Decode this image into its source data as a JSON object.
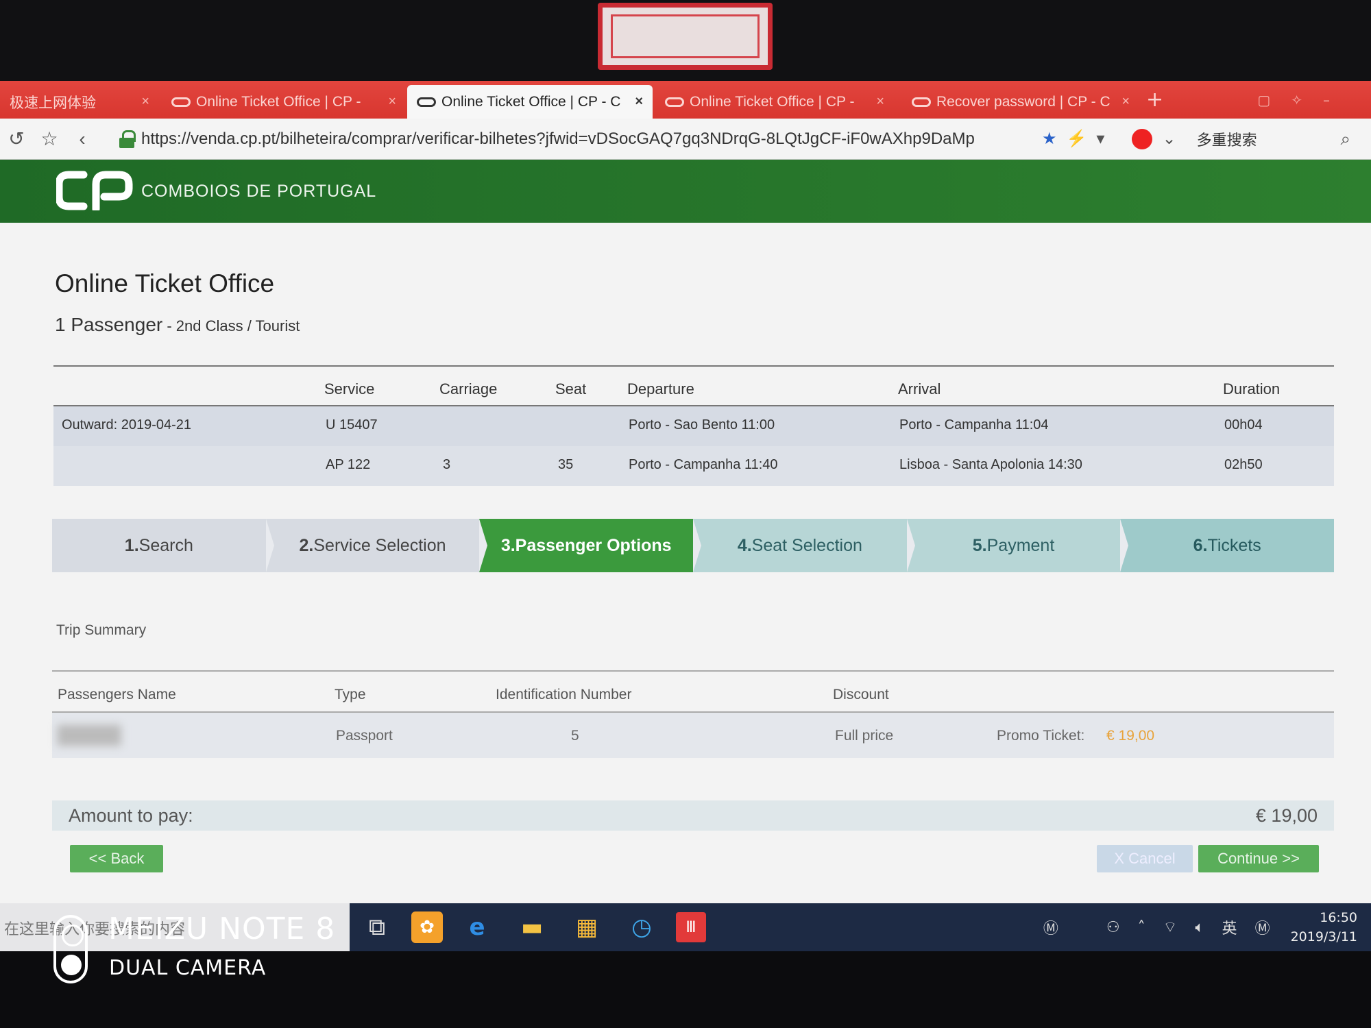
{
  "browser": {
    "tabs": [
      {
        "label": "极速上网体验",
        "active": false
      },
      {
        "label": "Online Ticket Office | CP -",
        "active": false
      },
      {
        "label": "Online Ticket Office | CP - C",
        "active": true
      },
      {
        "label": "Online Ticket Office | CP -",
        "active": false
      },
      {
        "label": "Recover password | CP - C",
        "active": false
      }
    ],
    "new_tab": "+",
    "url": "https://venda.cp.pt/bilheteira/comprar/verificar-bilhetes?jfwid=vDSocGAQ7gq3NDrqG-8LQtJgCF-iF0wAXhp9DaMp",
    "search_engine_label": "多重搜索"
  },
  "site": {
    "name": "COMBOIOS DE PORTUGAL",
    "brand_color": "#2d7f2f"
  },
  "page": {
    "title": "Online Ticket Office",
    "passenger_count": "1 Passenger",
    "passenger_class": " - 2nd Class / Tourist"
  },
  "trips": {
    "headers": [
      "Service",
      "Carriage",
      "Seat",
      "Departure",
      "Arrival",
      "Duration"
    ],
    "rows": [
      {
        "label": "Outward: 2019-04-21",
        "service": "U 15407",
        "carriage": "",
        "seat": "",
        "departure": "Porto - Sao Bento 11:00",
        "arrival": "Porto - Campanha 11:04",
        "duration": "00h04"
      },
      {
        "label": "",
        "service": "AP 122",
        "carriage": "3",
        "seat": "35",
        "departure": "Porto - Campanha 11:40",
        "arrival": "Lisboa - Santa Apolonia 14:30",
        "duration": "02h50"
      }
    ]
  },
  "steps": [
    {
      "num": "1.",
      "label": "Search"
    },
    {
      "num": "2.",
      "label": "Service Selection"
    },
    {
      "num": "3.",
      "label": "Passenger Options"
    },
    {
      "num": "4.",
      "label": "Seat Selection"
    },
    {
      "num": "5.",
      "label": "Payment"
    },
    {
      "num": "6.",
      "label": "Tickets"
    }
  ],
  "summary": {
    "label": "Trip Summary",
    "headers": [
      "Passengers Name",
      "Type",
      "Identification Number",
      "Discount"
    ],
    "row": {
      "name": "▇▇▇▇",
      "type": "Passport",
      "id_number": "5",
      "discount": "Full price",
      "promo_label": "Promo Ticket:",
      "promo_price": "€ 19,00"
    },
    "promo_color": "#e8a33a"
  },
  "payment": {
    "amount_label": "Amount to pay:",
    "amount_value": "€ 19,00"
  },
  "buttons": {
    "back": "<< Back",
    "cancel": "X Cancel",
    "continue": "Continue >>"
  },
  "taskbar": {
    "search_placeholder": "在这里输入你要搜索的内容",
    "tray_input": "英",
    "time": "16:50",
    "date": "2019/3/11"
  },
  "watermark": {
    "model": "MEIZU NOTE 8",
    "sub": "DUAL CAMERA"
  }
}
